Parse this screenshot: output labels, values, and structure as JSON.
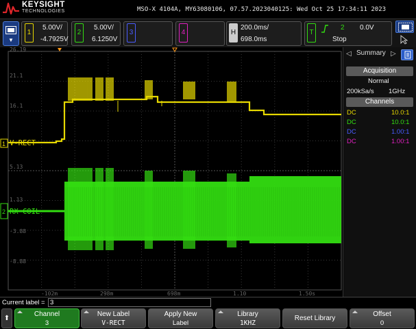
{
  "header": {
    "brand_name": "KEYSIGHT",
    "brand_sub": "TECHNOLOGIES",
    "instrument_info": "MSO-X 4104A, MY63080106, 07.57.2023040125: Wed Oct 25 17:34:11 2023"
  },
  "channels": [
    {
      "number": "1",
      "scale": "5.00V/",
      "offset": "-4.7925V",
      "color": "#e6d800"
    },
    {
      "number": "2",
      "scale": "5.00V/",
      "offset": "6.1250V",
      "color": "#33dd11"
    },
    {
      "number": "3",
      "color": "#4a5cff"
    },
    {
      "number": "4",
      "color": "#e020c0"
    }
  ],
  "horizontal": {
    "badge": "H",
    "scale": "200.0ms/",
    "delay": "698.0ms"
  },
  "trigger": {
    "badge": "T",
    "slope_icon": "rising-edge-icon",
    "source": "2",
    "level": "0.0V",
    "state": "Stop"
  },
  "graticule": {
    "y_labels": [
      "26.19",
      "21.1",
      "16.1",
      "5.13",
      "1.13",
      "-3.88",
      "-8.88"
    ],
    "x_labels": [
      "-102m",
      "298m",
      "698m",
      "1.10",
      "1.50s"
    ],
    "ch1_label": "V-RECT",
    "ch2_label": "RX-COIL",
    "ch1_marker": "1",
    "ch2_marker": "2"
  },
  "right_panel": {
    "tab_summary": "Summary",
    "acquisition_title": "Acquisition",
    "acq_mode": "Normal",
    "sample_rate": "200kSa/s",
    "bandwidth": "1GHz",
    "channels_title": "Channels",
    "channel_rows": [
      {
        "coupling": "DC",
        "probe": "10.0:1",
        "color": "#e6d800"
      },
      {
        "coupling": "DC",
        "probe": "10.0:1",
        "color": "#33dd11"
      },
      {
        "coupling": "DC",
        "probe": "1.00:1",
        "color": "#4a5cff"
      },
      {
        "coupling": "DC",
        "probe": "1.00:1",
        "color": "#e020c0"
      }
    ]
  },
  "label_bar": {
    "title": "Current label =",
    "value": "3"
  },
  "softkeys": [
    {
      "line1": "Channel",
      "line2": "3"
    },
    {
      "line1": "New Label",
      "line2": "V-RECT"
    },
    {
      "line1": "Apply New",
      "line2": "Label"
    },
    {
      "line1": "Library",
      "line2": "1KHZ"
    },
    {
      "line1": "Reset Library",
      "line2": ""
    },
    {
      "line1": "Offset",
      "line2": "0"
    }
  ]
}
